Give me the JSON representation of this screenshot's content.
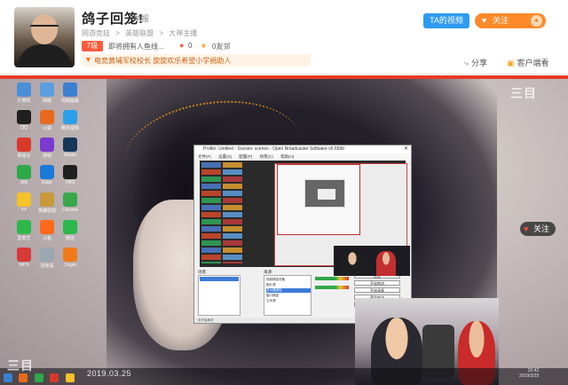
{
  "header": {
    "streamer_name": "鸽子回笼!",
    "report": "举报",
    "breadcrumb": [
      "网游竞技",
      ">",
      "英雄联盟",
      ">",
      "大神主播"
    ],
    "level_badge": "7级",
    "room_title": "即将拥有人鱼线...",
    "heat_count": "0",
    "fans_count": "0友邻",
    "notice": "电竞黄埔军校校长 旋旋欢乐希望小学捐助人",
    "ta_video_label": "TA的视频",
    "follow_label": "关注",
    "share_label": "分享",
    "client_label": "客户端看"
  },
  "video": {
    "watermark": "三目",
    "date_stamp": "2019.03.25",
    "float_follow_label": "关注",
    "tray_time": "20:42",
    "tray_date": "2019/3/25",
    "obs": {
      "title": "Profile: Untitled - Scenes: scenes - Open Broadcaster Software v0.659b",
      "menu": [
        "文件(F)",
        "设置(S)",
        "配置(P)",
        "场景(C)",
        "帮助(H)"
      ],
      "scenes_label": "场景:",
      "sources_label": "来源:",
      "scene_item": "场景",
      "sources": [
        "视频捕捉设备",
        "图片源",
        "显示器捕捉",
        "窗口捕捉",
        "文本源"
      ],
      "buttons": [
        "设置",
        "开始串流",
        "开始录像",
        "预览串流",
        "退出"
      ],
      "status": "未开始串流"
    }
  },
  "desktop_icons": [
    {
      "caption": "计算机",
      "color": "#4a8fd8"
    },
    {
      "caption": "网络",
      "color": "#5a9ee0"
    },
    {
      "caption": "控制面板",
      "color": "#3a7fd0"
    },
    {
      "caption": "QQ",
      "color": "#1f1f1f"
    },
    {
      "caption": "火狐",
      "color": "#e86a1a"
    },
    {
      "caption": "腾讯视频",
      "color": "#2aa0e8"
    },
    {
      "caption": "网易云",
      "color": "#d83a2a"
    },
    {
      "caption": "游戏",
      "color": "#7a3ad0"
    },
    {
      "caption": "Steam",
      "color": "#16365a"
    },
    {
      "caption": "360",
      "color": "#2fa84a"
    },
    {
      "caption": "Edge",
      "color": "#1a7ad8"
    },
    {
      "caption": "OBS",
      "color": "#202020"
    },
    {
      "caption": "YY",
      "color": "#f5c22a"
    },
    {
      "caption": "英雄联盟",
      "color": "#c89a3a"
    },
    {
      "caption": "Chrome",
      "color": "#3aa84a"
    },
    {
      "caption": "爱奇艺",
      "color": "#2fb84a"
    },
    {
      "caption": "斗鱼",
      "color": "#ff6a1a"
    },
    {
      "caption": "微信",
      "color": "#2ab84a"
    },
    {
      "caption": "WPS",
      "color": "#d83a3a"
    },
    {
      "caption": "回收站",
      "color": "#9aa6b0"
    },
    {
      "caption": "Origin",
      "color": "#f07a1a"
    }
  ]
}
